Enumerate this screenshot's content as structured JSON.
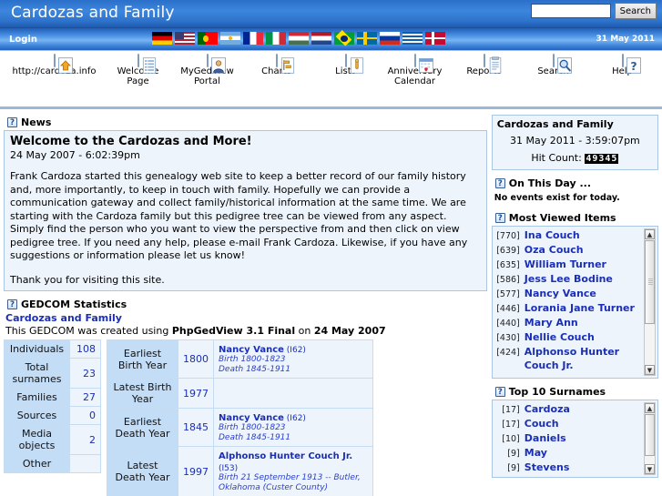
{
  "site": {
    "title": "Cardozas and Family",
    "login_label": "Login",
    "date_right": "31 May 2011"
  },
  "search": {
    "value": "",
    "placeholder": "",
    "button_label": "Search"
  },
  "flags": [
    {
      "name": "flag-germany",
      "colors": [
        "#000000",
        "#dd0000",
        "#ffce00"
      ]
    },
    {
      "name": "flag-usa",
      "colors": [
        "#b22234",
        "#ffffff",
        "#3c3b6e"
      ]
    },
    {
      "name": "flag-portugal",
      "colors": [
        "#006600",
        "#ff0000",
        "#ffcc00"
      ]
    },
    {
      "name": "flag-argentina",
      "colors": [
        "#74acdf",
        "#ffffff",
        "#f6b40e"
      ]
    },
    {
      "name": "flag-france",
      "colors": [
        "#002395",
        "#ffffff",
        "#ed2939"
      ]
    },
    {
      "name": "flag-italy",
      "colors": [
        "#009246",
        "#ffffff",
        "#ce2b37"
      ]
    },
    {
      "name": "flag-hungary",
      "colors": [
        "#ce2939",
        "#ffffff",
        "#477050"
      ]
    },
    {
      "name": "flag-netherlands",
      "colors": [
        "#ae1c28",
        "#ffffff",
        "#21468b"
      ]
    },
    {
      "name": "flag-brazil",
      "colors": [
        "#009c3b",
        "#ffdf00",
        "#002776"
      ]
    },
    {
      "name": "flag-sweden",
      "colors": [
        "#006aa7",
        "#fecc00",
        "#006aa7"
      ]
    },
    {
      "name": "flag-russia",
      "colors": [
        "#ffffff",
        "#0039a6",
        "#d52b1e"
      ]
    },
    {
      "name": "flag-greece",
      "colors": [
        "#0d5eaf",
        "#ffffff",
        "#0d5eaf"
      ]
    },
    {
      "name": "flag-denmark",
      "colors": [
        "#c60c30",
        "#ffffff",
        "#c60c30"
      ]
    }
  ],
  "nav": [
    {
      "label": "http://cardoza.info",
      "icon": "home-icon"
    },
    {
      "label": "Welcome\nPage",
      "icon": "list-page-icon"
    },
    {
      "label": "MyGedView\nPortal",
      "icon": "person-portal-icon"
    },
    {
      "label": "Charts",
      "icon": "chart-icon"
    },
    {
      "label": "Lists",
      "icon": "lists-icon"
    },
    {
      "label": "Anniversary\nCalendar",
      "icon": "calendar-heart-icon"
    },
    {
      "label": "Reports",
      "icon": "report-clipboard-icon"
    },
    {
      "label": "Search",
      "icon": "magnifier-icon"
    },
    {
      "label": "Help",
      "icon": "question-help-icon"
    }
  ],
  "news": {
    "block_title": "News",
    "title": "Welcome to the Cardozas and More!",
    "date": "24 May 2007 - 6:02:39pm",
    "paragraphs": [
      "Frank Cardoza started this genealogy web site to keep a better record of our family history and, more importantly, to keep in touch with family. Hopefully we can provide a communication gateway and collect family/historical information at the same time. We are starting with the Cardoza family but this pedigree tree can be viewed from any aspect. Simply find the person who you want to view the perspective from and then click on view pedigree tree. If you need any help, please e-mail Frank Cardoza. Likewise, if you have any suggestions or information please let us know!",
      "Thank you for visiting this site."
    ]
  },
  "gedcom": {
    "block_title": "GEDCOM Statistics",
    "subtitle": "Cardozas and Family",
    "created_prefix": "This GEDCOM was created using ",
    "created_app": "PhpGedView 3.1 Final",
    "created_on_word": " on ",
    "created_date": "24 May 2007",
    "counts": [
      {
        "label": "Individuals",
        "value": "108"
      },
      {
        "label": "Total surnames",
        "value": "23"
      },
      {
        "label": "Families",
        "value": "27"
      },
      {
        "label": "Sources",
        "value": "0"
      },
      {
        "label": "Media objects",
        "value": "2"
      },
      {
        "label": "Other",
        "value": ""
      }
    ],
    "years": [
      {
        "label": "Earliest Birth Year",
        "year": "1800",
        "person": "Nancy Vance",
        "pid": "(I62)",
        "events": [
          "Birth 1800-1823",
          "Death 1845-1911"
        ]
      },
      {
        "label": "Latest Birth Year",
        "year": "1977",
        "person": "",
        "pid": "",
        "events": []
      },
      {
        "label": "Earliest Death Year",
        "year": "1845",
        "person": "Nancy Vance",
        "pid": "(I62)",
        "events": [
          "Birth 1800-1823",
          "Death 1845-1911"
        ]
      },
      {
        "label": "Latest Death Year",
        "year": "1997",
        "person": "Alphonso Hunter Couch Jr.",
        "pid": "(I53)",
        "events": [
          "Birth 21 September 1913 -- Butler, Oklahoma (Custer County)"
        ]
      }
    ]
  },
  "sidebar": {
    "welcome": {
      "title": "Cardozas and Family",
      "datetime": "31 May 2011 - 3:59:07pm",
      "hit_label": "Hit Count:",
      "hit_count": "49345"
    },
    "on_this_day": {
      "title": "On This Day ...",
      "message": "No events exist for today."
    },
    "most_viewed": {
      "title": "Most Viewed Items",
      "items": [
        {
          "count": "[770]",
          "name": "Ina Couch"
        },
        {
          "count": "[639]",
          "name": "Oza Couch"
        },
        {
          "count": "[635]",
          "name": "William Turner"
        },
        {
          "count": "[586]",
          "name": "Jess Lee Bodine"
        },
        {
          "count": "[577]",
          "name": "Nancy Vance"
        },
        {
          "count": "[446]",
          "name": "Lorania Jane Turner"
        },
        {
          "count": "[440]",
          "name": "Mary Ann"
        },
        {
          "count": "[430]",
          "name": "Nellie Couch"
        },
        {
          "count": "[424]",
          "name": "Alphonso Hunter Couch Jr."
        }
      ]
    },
    "top_surnames": {
      "title": "Top 10 Surnames",
      "items": [
        {
          "count": "[17]",
          "name": "Cardoza"
        },
        {
          "count": "[17]",
          "name": "Couch"
        },
        {
          "count": "[10]",
          "name": "Daniels"
        },
        {
          "count": "[9]",
          "name": "May"
        },
        {
          "count": "[9]",
          "name": "Stevens"
        }
      ]
    }
  }
}
